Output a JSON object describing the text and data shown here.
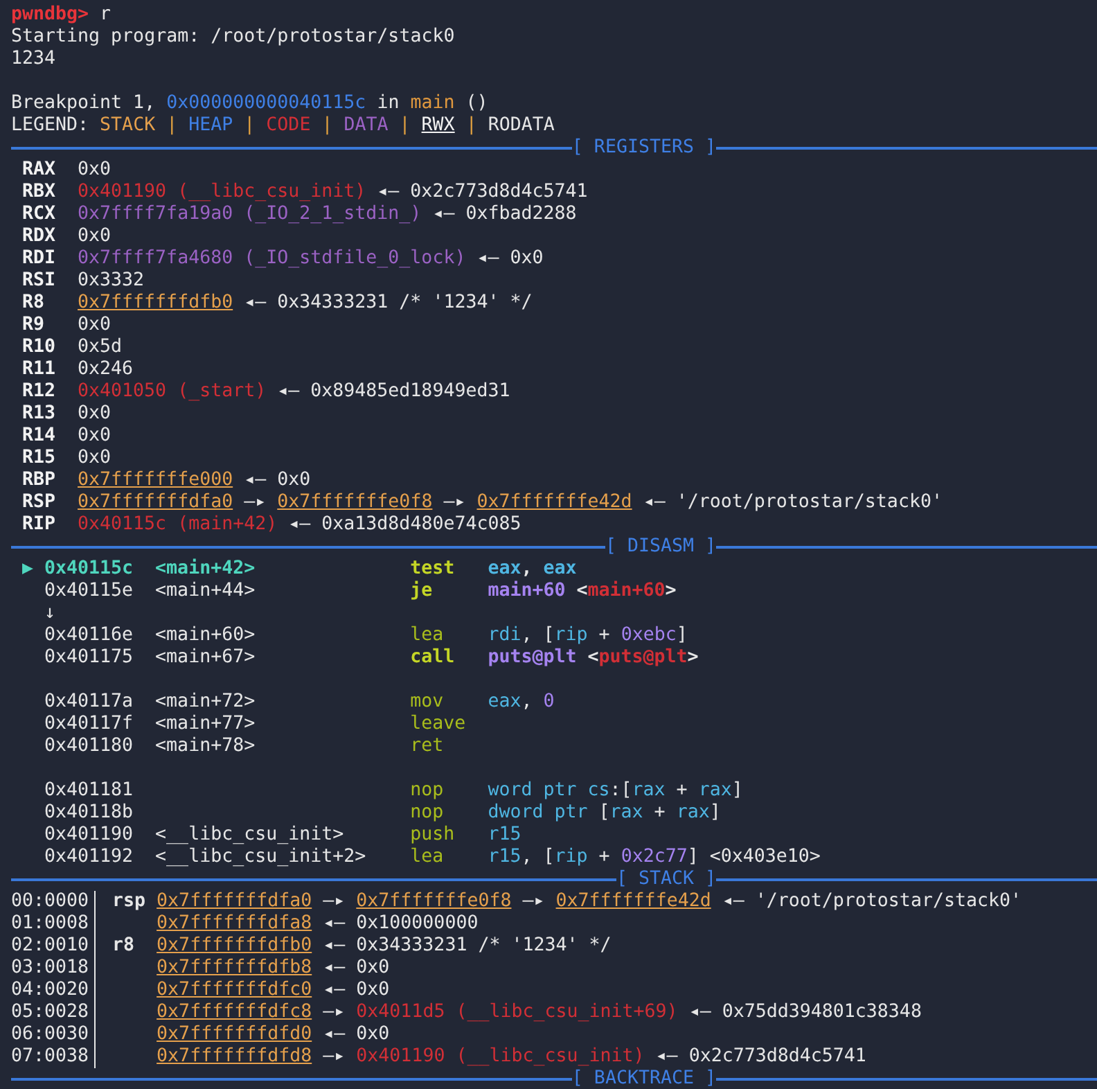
{
  "console": [
    {
      "kind": "text",
      "parts": [
        {
          "text": "pwndbg>",
          "kind": "prompt"
        },
        {
          "text": " r",
          "kind": "plain"
        }
      ]
    },
    {
      "kind": "text",
      "parts": [
        {
          "text": "Starting program: /root/protostar/stack0",
          "kind": "plain"
        }
      ]
    },
    {
      "kind": "text",
      "parts": [
        {
          "text": "1234",
          "kind": "plain"
        }
      ]
    },
    {
      "kind": "blank"
    },
    {
      "kind": "text",
      "parts": [
        {
          "text": "Breakpoint 1, ",
          "kind": "plain"
        },
        {
          "text": "0x000000000040115c",
          "kind": "number"
        },
        {
          "text": " in ",
          "kind": "plain"
        },
        {
          "text": "main",
          "kind": "func"
        },
        {
          "text": " ()",
          "kind": "plain"
        }
      ]
    },
    {
      "kind": "text",
      "parts": [
        {
          "text": "LEGEND: ",
          "kind": "plain"
        },
        {
          "text": "STACK",
          "kind": "stack"
        },
        {
          "text": " | ",
          "kind": "sep"
        },
        {
          "text": "HEAP",
          "kind": "heap"
        },
        {
          "text": " | ",
          "kind": "sep"
        },
        {
          "text": "CODE",
          "kind": "code"
        },
        {
          "text": " | ",
          "kind": "sep"
        },
        {
          "text": "DATA",
          "kind": "data"
        },
        {
          "text": " | ",
          "kind": "sep"
        },
        {
          "text": "RWX",
          "kind": "rwx"
        },
        {
          "text": " | ",
          "kind": "sep"
        },
        {
          "text": "RODATA",
          "kind": "plain"
        }
      ]
    }
  ],
  "sections": [
    {
      "kind": "registers",
      "title": "[ REGISTERS ]",
      "rows": [
        {
          "name": "RAX",
          "parts": [
            {
              "text": "0x0",
              "kind": "plain"
            }
          ]
        },
        {
          "name": "RBX",
          "parts": [
            {
              "text": "0x401190 (__libc_csu_init)",
              "kind": "code"
            },
            {
              "text": " ◂— 0x2c773d8d4c5741",
              "kind": "plain"
            }
          ]
        },
        {
          "name": "RCX",
          "parts": [
            {
              "text": "0x7ffff7fa19a0 (_IO_2_1_stdin_)",
              "kind": "data"
            },
            {
              "text": " ◂— 0xfbad2288",
              "kind": "plain"
            }
          ]
        },
        {
          "name": "RDX",
          "parts": [
            {
              "text": "0x0",
              "kind": "plain"
            }
          ]
        },
        {
          "name": "RDI",
          "parts": [
            {
              "text": "0x7ffff7fa4680 (_IO_stdfile_0_lock)",
              "kind": "data"
            },
            {
              "text": " ◂— 0x0",
              "kind": "plain"
            }
          ]
        },
        {
          "name": "RSI",
          "parts": [
            {
              "text": "0x3332",
              "kind": "plain"
            }
          ]
        },
        {
          "name": "R8",
          "parts": [
            {
              "text": "0x7fffffffdfb0",
              "kind": "stackptr"
            },
            {
              "text": " ◂— 0x34333231 /* '1234' */",
              "kind": "plain"
            }
          ]
        },
        {
          "name": "R9",
          "parts": [
            {
              "text": "0x0",
              "kind": "plain"
            }
          ]
        },
        {
          "name": "R10",
          "parts": [
            {
              "text": "0x5d",
              "kind": "plain"
            }
          ]
        },
        {
          "name": "R11",
          "parts": [
            {
              "text": "0x246",
              "kind": "plain"
            }
          ]
        },
        {
          "name": "R12",
          "parts": [
            {
              "text": "0x401050 (_start)",
              "kind": "code"
            },
            {
              "text": " ◂— 0x89485ed18949ed31",
              "kind": "plain"
            }
          ]
        },
        {
          "name": "R13",
          "parts": [
            {
              "text": "0x0",
              "kind": "plain"
            }
          ]
        },
        {
          "name": "R14",
          "parts": [
            {
              "text": "0x0",
              "kind": "plain"
            }
          ]
        },
        {
          "name": "R15",
          "parts": [
            {
              "text": "0x0",
              "kind": "plain"
            }
          ]
        },
        {
          "name": "RBP",
          "parts": [
            {
              "text": "0x7fffffffe000",
              "kind": "stackptr"
            },
            {
              "text": " ◂— 0x0",
              "kind": "plain"
            }
          ]
        },
        {
          "name": "RSP",
          "parts": [
            {
              "text": "0x7fffffffdfa0",
              "kind": "stackptr"
            },
            {
              "text": " —▸ ",
              "kind": "plain"
            },
            {
              "text": "0x7fffffffe0f8",
              "kind": "stackptr"
            },
            {
              "text": " —▸ ",
              "kind": "plain"
            },
            {
              "text": "0x7fffffffe42d",
              "kind": "stackptr"
            },
            {
              "text": " ◂— '/root/protostar/stack0'",
              "kind": "plain"
            }
          ]
        },
        {
          "name": "RIP",
          "parts": [
            {
              "text": "0x40115c (main+42)",
              "kind": "code"
            },
            {
              "text": " ◂— 0xa13d8d480e74c085",
              "kind": "plain"
            }
          ]
        }
      ]
    },
    {
      "kind": "disasm",
      "title": "[ DISASM ]",
      "rows": [
        {
          "kind": "instruction",
          "current": true,
          "marker": "▶",
          "address": "0x40115c",
          "symbol": "<main+42>",
          "mnemonic": "test",
          "emphasized": true,
          "operands": [
            {
              "text": "eax",
              "kind": "reg"
            },
            {
              "text": ", ",
              "kind": "plain"
            },
            {
              "text": "eax",
              "kind": "reg"
            }
          ]
        },
        {
          "kind": "instruction",
          "current": false,
          "address": "0x40115e",
          "symbol": "<main+44>",
          "mnemonic": "je",
          "emphasized": true,
          "operands": [
            {
              "text": "main+60",
              "kind": "const"
            },
            {
              "text": " <",
              "kind": "plain"
            },
            {
              "text": "main+60",
              "kind": "code"
            },
            {
              "text": ">",
              "kind": "plain"
            }
          ]
        },
        {
          "kind": "jump",
          "text": "↓"
        },
        {
          "kind": "instruction",
          "current": false,
          "address": "0x40116e",
          "symbol": "<main+60>",
          "mnemonic": "lea",
          "emphasized": false,
          "operands": [
            {
              "text": "rdi",
              "kind": "reg"
            },
            {
              "text": ", [",
              "kind": "plain"
            },
            {
              "text": "rip",
              "kind": "reg"
            },
            {
              "text": " + ",
              "kind": "plain"
            },
            {
              "text": "0xebc",
              "kind": "const"
            },
            {
              "text": "]",
              "kind": "plain"
            }
          ]
        },
        {
          "kind": "instruction",
          "current": false,
          "address": "0x401175",
          "symbol": "<main+67>",
          "mnemonic": "call",
          "emphasized": true,
          "operands": [
            {
              "text": "puts@plt",
              "kind": "const"
            },
            {
              "text": " <",
              "kind": "plain"
            },
            {
              "text": "puts@plt",
              "kind": "code"
            },
            {
              "text": ">",
              "kind": "plain"
            }
          ]
        },
        {
          "kind": "blank"
        },
        {
          "kind": "instruction",
          "current": false,
          "address": "0x40117a",
          "symbol": "<main+72>",
          "mnemonic": "mov",
          "emphasized": false,
          "operands": [
            {
              "text": "eax",
              "kind": "reg"
            },
            {
              "text": ", ",
              "kind": "plain"
            },
            {
              "text": "0",
              "kind": "const"
            }
          ]
        },
        {
          "kind": "instruction",
          "current": false,
          "address": "0x40117f",
          "symbol": "<main+77>",
          "mnemonic": "leave",
          "emphasized": false
        },
        {
          "kind": "instruction",
          "current": false,
          "address": "0x401180",
          "symbol": "<main+78>",
          "mnemonic": "ret",
          "emphasized": false
        },
        {
          "kind": "blank"
        },
        {
          "kind": "instruction",
          "current": false,
          "address": "0x401181",
          "mnemonic": "nop",
          "emphasized": false,
          "operands": [
            {
              "text": "word ptr cs",
              "kind": "reg"
            },
            {
              "text": ":[",
              "kind": "plain"
            },
            {
              "text": "rax",
              "kind": "reg"
            },
            {
              "text": " + ",
              "kind": "plain"
            },
            {
              "text": "rax",
              "kind": "reg"
            },
            {
              "text": "]",
              "kind": "plain"
            }
          ]
        },
        {
          "kind": "instruction",
          "current": false,
          "address": "0x40118b",
          "mnemonic": "nop",
          "emphasized": false,
          "operands": [
            {
              "text": "dword ptr",
              "kind": "reg"
            },
            {
              "text": " [",
              "kind": "plain"
            },
            {
              "text": "rax",
              "kind": "reg"
            },
            {
              "text": " + ",
              "kind": "plain"
            },
            {
              "text": "rax",
              "kind": "reg"
            },
            {
              "text": "]",
              "kind": "plain"
            }
          ]
        },
        {
          "kind": "instruction",
          "current": false,
          "address": "0x401190",
          "symbol": "<__libc_csu_init>",
          "mnemonic": "push",
          "emphasized": false,
          "operands": [
            {
              "text": "r15",
              "kind": "reg"
            }
          ]
        },
        {
          "kind": "instruction",
          "current": false,
          "address": "0x401192",
          "symbol": "<__libc_csu_init+2>",
          "mnemonic": "lea",
          "emphasized": false,
          "operands": [
            {
              "text": "r15",
              "kind": "reg"
            },
            {
              "text": ", [",
              "kind": "plain"
            },
            {
              "text": "rip",
              "kind": "reg"
            },
            {
              "text": " + ",
              "kind": "plain"
            },
            {
              "text": "0x2c77",
              "kind": "const"
            },
            {
              "text": "] <0x403e10>",
              "kind": "plain"
            }
          ]
        }
      ]
    },
    {
      "kind": "stack",
      "title": "[ STACK ]",
      "rows": [
        {
          "offset": "00:0000",
          "register": "rsp",
          "parts": [
            {
              "text": "0x7fffffffdfa0",
              "kind": "stackptr"
            },
            {
              "text": " —▸ ",
              "kind": "plain"
            },
            {
              "text": "0x7fffffffe0f8",
              "kind": "stackptr"
            },
            {
              "text": " —▸ ",
              "kind": "plain"
            },
            {
              "text": "0x7fffffffe42d",
              "kind": "stackptr"
            },
            {
              "text": " ◂— '/root/protostar/stack0'",
              "kind": "plain"
            }
          ]
        },
        {
          "offset": "01:0008",
          "parts": [
            {
              "text": "0x7fffffffdfa8",
              "kind": "stackptr"
            },
            {
              "text": " ◂— 0x100000000",
              "kind": "plain"
            }
          ]
        },
        {
          "offset": "02:0010",
          "register": "r8",
          "parts": [
            {
              "text": "0x7fffffffdfb0",
              "kind": "stackptr"
            },
            {
              "text": " ◂— 0x34333231 /* '1234' */",
              "kind": "plain"
            }
          ]
        },
        {
          "offset": "03:0018",
          "parts": [
            {
              "text": "0x7fffffffdfb8",
              "kind": "stackptr"
            },
            {
              "text": " ◂— 0x0",
              "kind": "plain"
            }
          ]
        },
        {
          "offset": "04:0020",
          "parts": [
            {
              "text": "0x7fffffffdfc0",
              "kind": "stackptr"
            },
            {
              "text": " ◂— 0x0",
              "kind": "plain"
            }
          ]
        },
        {
          "offset": "05:0028",
          "parts": [
            {
              "text": "0x7fffffffdfc8",
              "kind": "stackptr"
            },
            {
              "text": " —▸ ",
              "kind": "plain"
            },
            {
              "text": "0x4011d5 (__libc_csu_init+69)",
              "kind": "code"
            },
            {
              "text": " ◂— 0x75dd394801c38348",
              "kind": "plain"
            }
          ]
        },
        {
          "offset": "06:0030",
          "parts": [
            {
              "text": "0x7fffffffdfd0",
              "kind": "stackptr"
            },
            {
              "text": " ◂— 0x0",
              "kind": "plain"
            }
          ]
        },
        {
          "offset": "07:0038",
          "parts": [
            {
              "text": "0x7fffffffdfd8",
              "kind": "stackptr"
            },
            {
              "text": " —▸ ",
              "kind": "plain"
            },
            {
              "text": "0x401190 (__libc_csu_init)",
              "kind": "code"
            },
            {
              "text": " ◂— 0x2c773d8d4c5741",
              "kind": "plain"
            }
          ]
        }
      ]
    },
    {
      "kind": "backtrace",
      "title": "[ BACKTRACE ]"
    }
  ]
}
